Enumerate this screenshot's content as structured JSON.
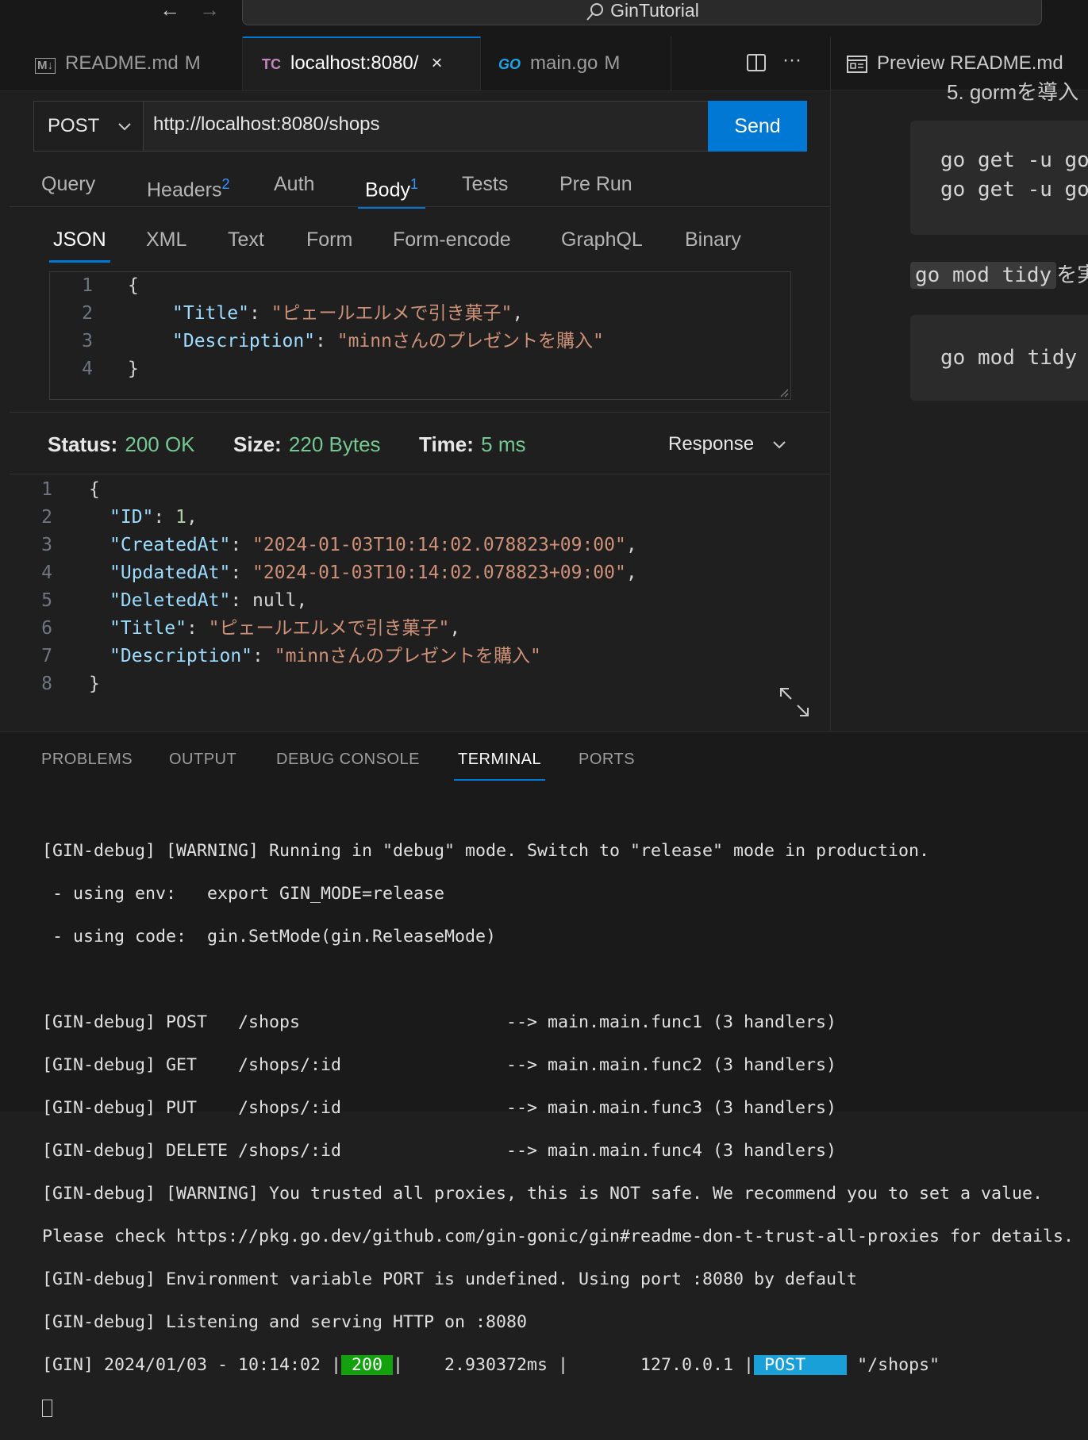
{
  "titlebar": {
    "title": "GinTutorial",
    "back": "←",
    "forward": "→"
  },
  "tabs": [
    {
      "label": "README.md",
      "modified": "M",
      "icon": "M↓"
    },
    {
      "label": "localhost:8080/",
      "icon": "TC",
      "close": "×"
    },
    {
      "label": "main.go",
      "modified": "M",
      "icon": "GO"
    }
  ],
  "editor_actions": {
    "more": "···"
  },
  "preview": {
    "tab_label": "Preview README.md",
    "partial_heading": "5. gormを導入",
    "code1": "go get -u go\ngo get -u go",
    "inline_code": "go mod tidy",
    "inline_suffix": "を実",
    "code2": "go mod tidy"
  },
  "request": {
    "method": "POST",
    "url": "http://localhost:8080/shops",
    "send_label": "Send",
    "tabs": [
      {
        "label": "Query"
      },
      {
        "label": "Headers",
        "count": "2"
      },
      {
        "label": "Auth"
      },
      {
        "label": "Body",
        "count": "1"
      },
      {
        "label": "Tests"
      },
      {
        "label": "Pre Run"
      }
    ],
    "body_tabs": [
      "JSON",
      "XML",
      "Text",
      "Form",
      "Form-encode",
      "GraphQL",
      "Binary"
    ],
    "body_lines": {
      "n1": "1",
      "n2": "2",
      "n3": "3",
      "n4": "4",
      "open": "{",
      "title_key": "\"Title\"",
      "title_val": "\"ピェールエルメで引き菓子\"",
      "desc_key": "\"Description\"",
      "desc_val": "\"minnさんのプレゼントを購入\"",
      "close": "}"
    }
  },
  "status": {
    "status_label": "Status:",
    "status_value": "200 OK",
    "size_label": "Size:",
    "size_value": "220 Bytes",
    "time_label": "Time:",
    "time_value": "5 ms",
    "response_select": "Response"
  },
  "response": {
    "id_key": "\"ID\"",
    "id_val": "1",
    "created_key": "\"CreatedAt\"",
    "created_val": "\"2024-01-03T10:14:02.078823+09:00\"",
    "updated_key": "\"UpdatedAt\"",
    "updated_val": "\"2024-01-03T10:14:02.078823+09:00\"",
    "deleted_key": "\"DeletedAt\"",
    "deleted_val": "null",
    "title_key": "\"Title\"",
    "title_val": "\"ピェールエルメで引き菓子\"",
    "desc_key": "\"Description\"",
    "desc_val": "\"minnさんのプレゼントを購入\"",
    "open": "{",
    "close": "}",
    "n": [
      "1",
      "2",
      "3",
      "4",
      "5",
      "6",
      "7",
      "8"
    ]
  },
  "panel": {
    "tabs": [
      "PROBLEMS",
      "OUTPUT",
      "DEBUG CONSOLE",
      "TERMINAL",
      "PORTS"
    ],
    "terminal_lines": [
      "[GIN-debug] [WARNING] Running in \"debug\" mode. Switch to \"release\" mode in production.",
      " - using env:   export GIN_MODE=release",
      " - using code:  gin.SetMode(gin.ReleaseMode)",
      "",
      "[GIN-debug] POST   /shops                    --> main.main.func1 (3 handlers)",
      "[GIN-debug] GET    /shops/:id                --> main.main.func2 (3 handlers)",
      "[GIN-debug] PUT    /shops/:id                --> main.main.func3 (3 handlers)",
      "[GIN-debug] DELETE /shops/:id                --> main.main.func4 (3 handlers)",
      "[GIN-debug] [WARNING] You trusted all proxies, this is NOT safe. We recommend you to set a value.",
      "Please check https://pkg.go.dev/github.com/gin-gonic/gin#readme-don-t-trust-all-proxies for details.",
      "[GIN-debug] Environment variable PORT is undefined. Using port :8080 by default",
      "[GIN-debug] Listening and serving HTTP on :8080"
    ],
    "log": {
      "prefix": "[GIN] 2024/01/03 - 10:14:02 |",
      "code": " 200 ",
      "mid": "|    2.930372ms |       127.0.0.1 |",
      "method": " POST    ",
      "path": " \"/shops\""
    }
  }
}
